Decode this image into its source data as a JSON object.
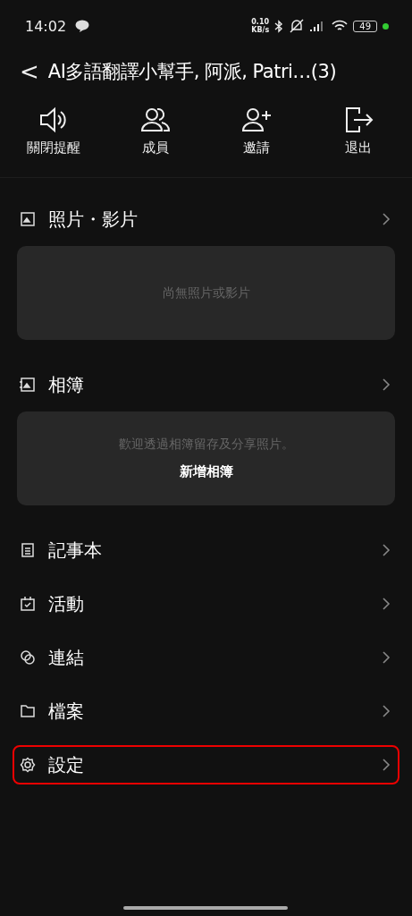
{
  "status_bar": {
    "time": "14:02",
    "net_speed": "0.10",
    "net_unit": "KB/s",
    "battery": "49"
  },
  "header": {
    "back": "<",
    "title": "AI多語翻譯小幫手, 阿派, Patri…(3)"
  },
  "actions": [
    {
      "label": "關閉提醒"
    },
    {
      "label": "成員"
    },
    {
      "label": "邀請"
    },
    {
      "label": "退出"
    }
  ],
  "sections": [
    {
      "kind": "card",
      "label": "照片・影片",
      "highlighted": false,
      "card": {
        "message": "尚無照片或影片"
      }
    },
    {
      "kind": "card",
      "label": "相簿",
      "highlighted": false,
      "card": {
        "message": "歡迎透過相簿留存及分享照片。",
        "action": "新增相簿"
      }
    },
    {
      "kind": "row",
      "label": "記事本",
      "highlighted": false
    },
    {
      "kind": "row",
      "label": "活動",
      "highlighted": false
    },
    {
      "kind": "row",
      "label": "連結",
      "highlighted": false
    },
    {
      "kind": "row",
      "label": "檔案",
      "highlighted": false
    },
    {
      "kind": "row",
      "label": "設定",
      "highlighted": true
    }
  ]
}
